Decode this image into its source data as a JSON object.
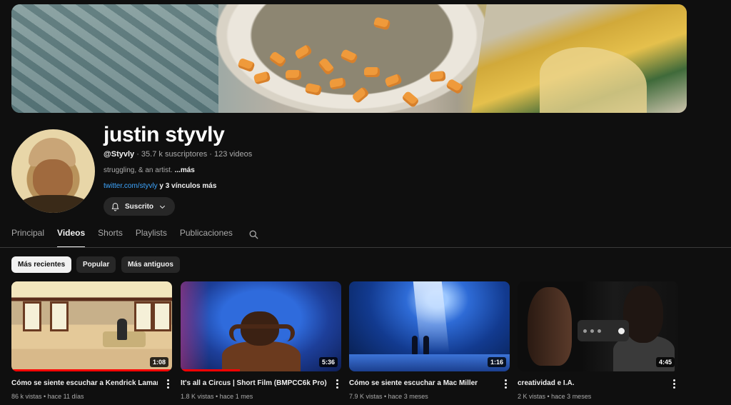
{
  "channel": {
    "name": "justin styvly",
    "handle": "@Styvly",
    "stats": " · 35.7 k suscriptores · 123 videos",
    "description": "struggling, & an artist. ",
    "description_more": "...más",
    "link_url": "twitter.com/styvly",
    "link_extra": " y 3 vínculos más",
    "subscribe_label": "Suscrito"
  },
  "tabs": [
    "Principal",
    "Videos",
    "Shorts",
    "Playlists",
    "Publicaciones"
  ],
  "active_tab": "Videos",
  "filters": [
    "Más recientes",
    "Popular",
    "Más antiguos"
  ],
  "active_filter": "Más recientes",
  "videos": [
    {
      "title": "Cómo se siente escuchar a Kendrick Lamar",
      "meta": "86 k vistas • hace 11 días",
      "duration": "1:08",
      "watched": 1.0
    },
    {
      "title": "It's all a Circus | Short Film (BMPCC6k Pro)",
      "meta": "1.8 K vistas • hace 1 mes",
      "duration": "5:36",
      "watched": 0.37
    },
    {
      "title": "Cómo se siente escuchar a Mac Miller",
      "meta": "7.9 K vistas • hace 3 meses",
      "duration": "1:16",
      "watched": 0
    },
    {
      "title": "creatividad e I.A.",
      "meta": "2 K vistas • hace 3 meses",
      "duration": "4:45",
      "watched": 0
    }
  ],
  "colors": {
    "background": "#0f0f0f",
    "link": "#3ea6ff",
    "progress": "#ff0000",
    "chip": "#272727"
  },
  "icons": {
    "subscribe": "bell-icon",
    "dropdown": "chevron-down-icon",
    "search": "search-icon",
    "more": "more-vert-icon"
  }
}
